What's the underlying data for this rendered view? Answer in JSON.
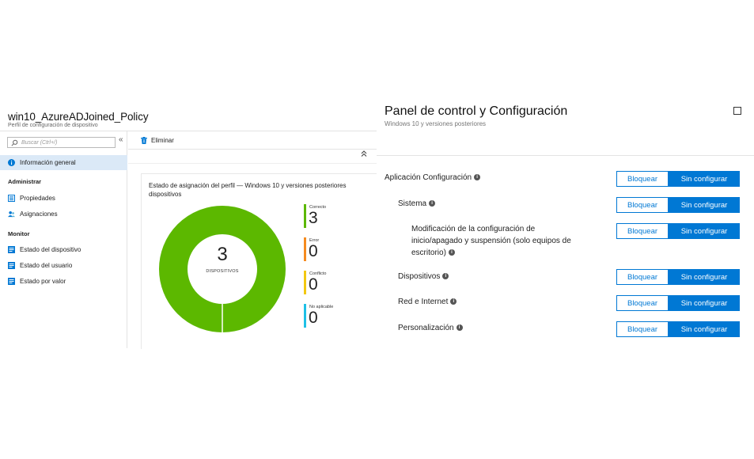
{
  "left_blade": {
    "title": "win10_AzureADJoined_Policy",
    "subtitle": "Perfil de configuración de dispositivo",
    "search_placeholder": "Buscar (Ctrl+/)",
    "collapse_glyph": "«",
    "nav": {
      "overview": "Información general",
      "admin_header": "Administrar",
      "properties": "Propiedades",
      "assignments": "Asignaciones",
      "monitor_header": "Monitor",
      "device_status": "Estado del dispositivo",
      "user_status": "Estado del usuario",
      "per_setting_status": "Estado por valor"
    },
    "toolbar": {
      "delete_label": "Eliminar",
      "collapse_up": "»"
    },
    "card": {
      "title": "Estado de asignación del perfil — Windows 10 y versiones posteriores dispositivos",
      "total": "3",
      "total_label": "DISPOSITIVOS",
      "legend": [
        {
          "label": "Correcto",
          "value": "3",
          "color": "#5cb800"
        },
        {
          "label": "Error",
          "value": "0",
          "color": "#f58b1f"
        },
        {
          "label": "Conflicto",
          "value": "0",
          "color": "#f2c811"
        },
        {
          "label": "No aplicable",
          "value": "0",
          "color": "#1ec0e6"
        }
      ]
    }
  },
  "chart_data": {
    "type": "pie",
    "categories": [
      "Correcto",
      "Error",
      "Conflicto",
      "No aplicable"
    ],
    "values": [
      3,
      0,
      0,
      0
    ],
    "colors": [
      "#5cb800",
      "#f58b1f",
      "#f2c811",
      "#1ec0e6"
    ],
    "title": "Estado de asignación del perfil — Windows 10 y versiones posteriores dispositivos"
  },
  "right_blade": {
    "title": "Panel de control y Configuración",
    "subtitle": "Windows 10 y versiones posteriores",
    "info_glyph": "i",
    "block_label": "Bloquear",
    "not_configured_label": "Sin configurar",
    "settings": {
      "app_config": "Aplicación Configuración",
      "system": "Sistema",
      "power_line1": "Modificación de la configuración de",
      "power_line2": "inicio/apagado y suspensión (solo equipos de",
      "power_line3": "escritorio)",
      "devices": "Dispositivos",
      "network": "Red e Internet",
      "personalization": "Personalización"
    }
  }
}
